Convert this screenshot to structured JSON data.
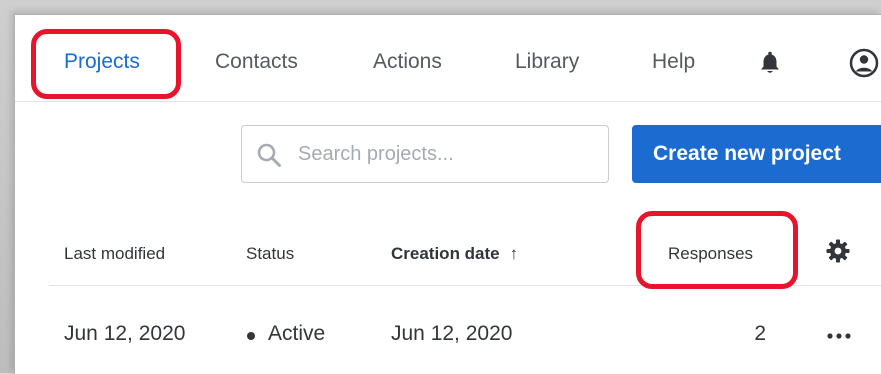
{
  "nav": {
    "items": [
      {
        "label": "Projects",
        "active": true
      },
      {
        "label": "Contacts",
        "active": false
      },
      {
        "label": "Actions",
        "active": false
      },
      {
        "label": "Library",
        "active": false
      },
      {
        "label": "Help",
        "active": false
      }
    ],
    "icons": [
      "bell-icon",
      "avatar-icon"
    ]
  },
  "search": {
    "placeholder": "Search projects...",
    "value": "",
    "icon": "search-icon"
  },
  "create_button": {
    "label": "Create new project"
  },
  "table": {
    "columns": [
      {
        "label": "Last modified"
      },
      {
        "label": "Status"
      },
      {
        "label": "Creation date",
        "sort_indicator": "↑"
      },
      {
        "label": "Responses"
      }
    ],
    "settings_icon": "gear-icon",
    "rows": [
      {
        "last_modified": "Jun 12, 2020",
        "status": "Active",
        "creation_date": "Jun 12, 2020",
        "responses": "2",
        "actions_icon": "more-icon"
      }
    ]
  },
  "colors": {
    "accent": "#1b6bd1",
    "highlight": "#e8142b",
    "text": "#32363a",
    "muted": "#555a60"
  }
}
